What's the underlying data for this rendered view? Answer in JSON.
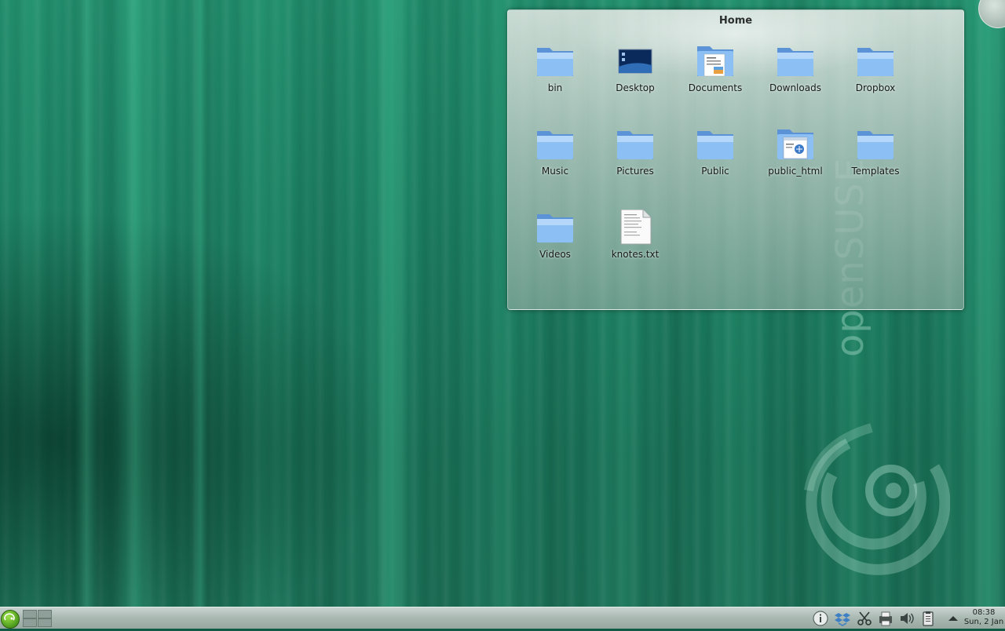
{
  "folder_view": {
    "title": "Home",
    "items": [
      {
        "label": "bin",
        "icon": "folder-icon"
      },
      {
        "label": "Desktop",
        "icon": "desktop-folder-icon"
      },
      {
        "label": "Documents",
        "icon": "documents-folder-icon"
      },
      {
        "label": "Downloads",
        "icon": "folder-icon"
      },
      {
        "label": "Dropbox",
        "icon": "folder-icon"
      },
      {
        "label": "Music",
        "icon": "folder-icon"
      },
      {
        "label": "Pictures",
        "icon": "folder-icon"
      },
      {
        "label": "Public",
        "icon": "folder-icon"
      },
      {
        "label": "public_html",
        "icon": "html-folder-icon"
      },
      {
        "label": "Templates",
        "icon": "folder-icon"
      },
      {
        "label": "Videos",
        "icon": "folder-icon"
      },
      {
        "label": "knotes.txt",
        "icon": "text-file-icon"
      }
    ]
  },
  "wallpaper": {
    "brand": "openSUSE"
  },
  "taskbar": {
    "clock_time": "08:38",
    "clock_date": "Sun, 2 Jan",
    "tray_icons": [
      "info-icon",
      "dropbox-icon",
      "klipper-scissors-icon",
      "printer-icon",
      "volume-icon",
      "clipboard-icon",
      "expand-tray-arrow-icon"
    ]
  },
  "colors": {
    "wallpaper_base": "#1a7c5f",
    "panel": "#a9b8b2",
    "folder_blue": "#7fb4ee",
    "launcher_green": "#6fbf2a"
  }
}
